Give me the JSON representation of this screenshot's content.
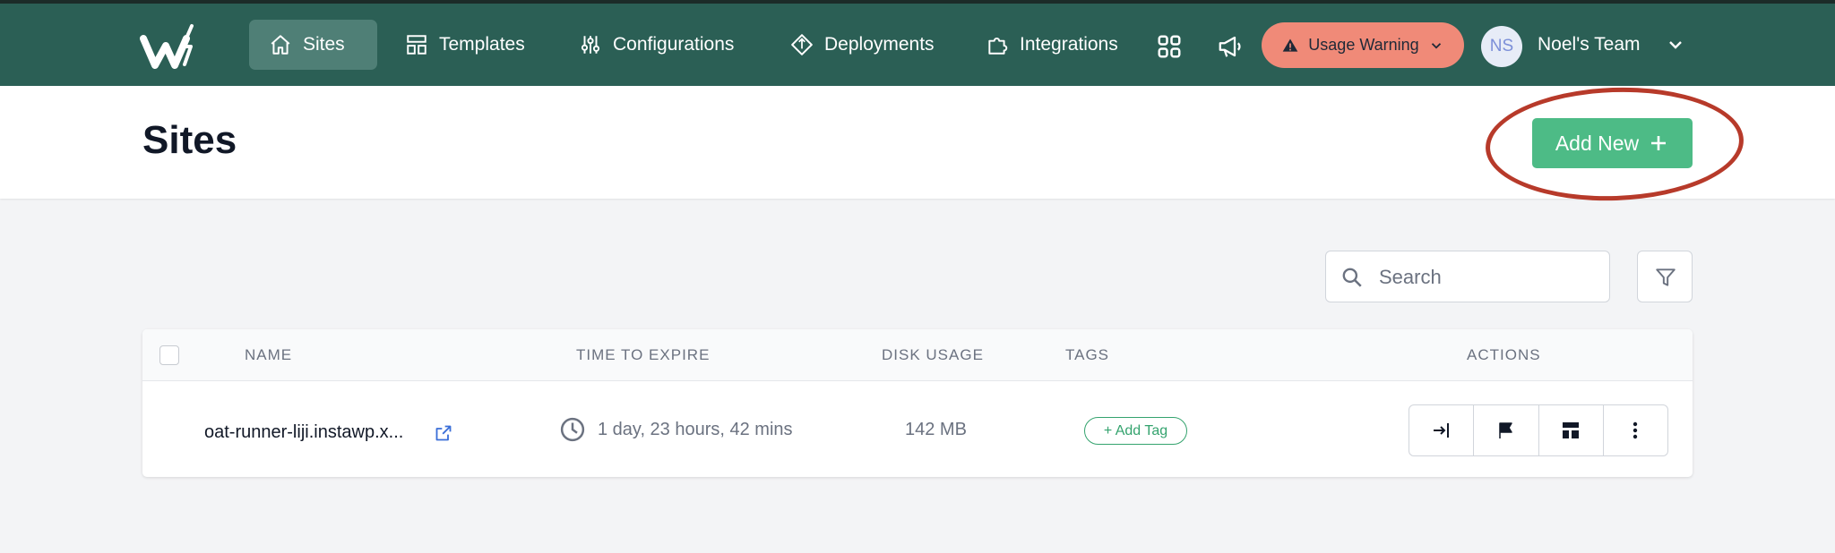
{
  "colors": {
    "navbar": "#2b5f55",
    "nav_active": "#4f7f76",
    "warning_bg": "#f08a78",
    "primary_green": "#4dbb86",
    "tag_green": "#34a36e",
    "highlight": "#b73a2a",
    "page_bg": "#f3f4f6"
  },
  "nav": {
    "logo_icon": "instawp-logo",
    "items": [
      {
        "label": "Sites",
        "icon": "home-icon",
        "active": true
      },
      {
        "label": "Templates",
        "icon": "templates-icon"
      },
      {
        "label": "Configurations",
        "icon": "sliders-icon"
      },
      {
        "label": "Deployments",
        "icon": "deploy-icon"
      },
      {
        "label": "Integrations",
        "icon": "puzzle-icon"
      }
    ],
    "apps_icon": "grid-icon",
    "announce_icon": "megaphone-icon",
    "warning_label": "Usage Warning",
    "avatar_initials": "NS",
    "team_name": "Noel's Team"
  },
  "header": {
    "title": "Sites",
    "add_new_label": "Add New"
  },
  "toolbar": {
    "search_placeholder": "Search",
    "filter_icon": "filter-icon"
  },
  "table": {
    "columns": [
      "NAME",
      "TIME TO EXPIRE",
      "DISK USAGE",
      "TAGS",
      "ACTIONS"
    ],
    "rows": [
      {
        "name": "oat-runner-liji.instawp.x...",
        "expire": "1 day, 23 hours, 42 mins",
        "disk": "142 MB",
        "tag_button": "+ Add Tag"
      }
    ],
    "action_icons": [
      "login-icon",
      "flag-icon",
      "layout-icon",
      "more-icon"
    ]
  }
}
